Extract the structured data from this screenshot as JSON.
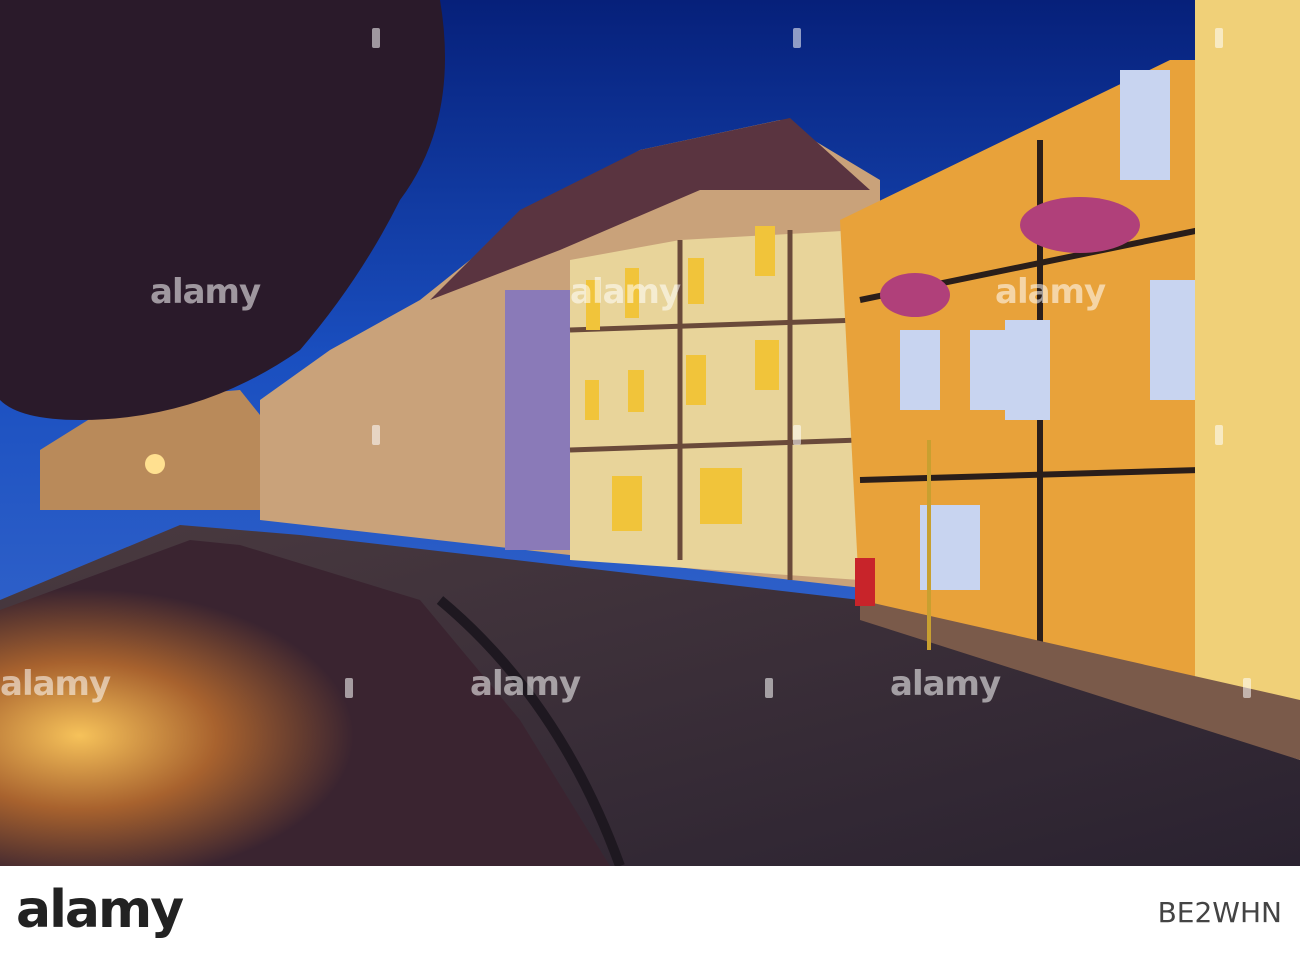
{
  "photo": {
    "description": "",
    "watermark_text": "alamy",
    "colors": {
      "sky": "#0a2f8e",
      "facade_orange": "#e8a23a",
      "street_light": "#f0b040"
    }
  },
  "footer": {
    "brand": "alamy",
    "image_id": "BE2WHN"
  }
}
